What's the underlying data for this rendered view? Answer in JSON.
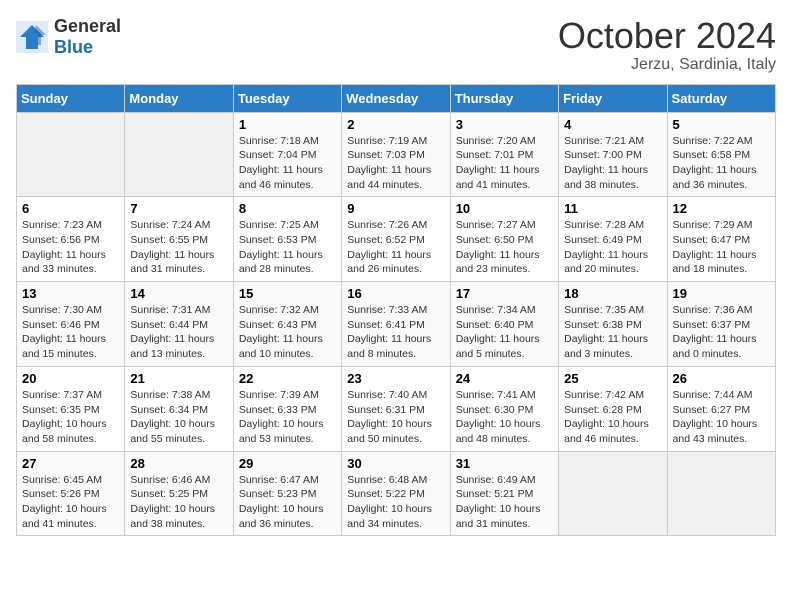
{
  "header": {
    "logo_general": "General",
    "logo_blue": "Blue",
    "month_title": "October 2024",
    "location": "Jerzu, Sardinia, Italy"
  },
  "weekdays": [
    "Sunday",
    "Monday",
    "Tuesday",
    "Wednesday",
    "Thursday",
    "Friday",
    "Saturday"
  ],
  "weeks": [
    [
      {
        "day": "",
        "info": ""
      },
      {
        "day": "",
        "info": ""
      },
      {
        "day": "1",
        "info": "Sunrise: 7:18 AM\nSunset: 7:04 PM\nDaylight: 11 hours and 46 minutes."
      },
      {
        "day": "2",
        "info": "Sunrise: 7:19 AM\nSunset: 7:03 PM\nDaylight: 11 hours and 44 minutes."
      },
      {
        "day": "3",
        "info": "Sunrise: 7:20 AM\nSunset: 7:01 PM\nDaylight: 11 hours and 41 minutes."
      },
      {
        "day": "4",
        "info": "Sunrise: 7:21 AM\nSunset: 7:00 PM\nDaylight: 11 hours and 38 minutes."
      },
      {
        "day": "5",
        "info": "Sunrise: 7:22 AM\nSunset: 6:58 PM\nDaylight: 11 hours and 36 minutes."
      }
    ],
    [
      {
        "day": "6",
        "info": "Sunrise: 7:23 AM\nSunset: 6:56 PM\nDaylight: 11 hours and 33 minutes."
      },
      {
        "day": "7",
        "info": "Sunrise: 7:24 AM\nSunset: 6:55 PM\nDaylight: 11 hours and 31 minutes."
      },
      {
        "day": "8",
        "info": "Sunrise: 7:25 AM\nSunset: 6:53 PM\nDaylight: 11 hours and 28 minutes."
      },
      {
        "day": "9",
        "info": "Sunrise: 7:26 AM\nSunset: 6:52 PM\nDaylight: 11 hours and 26 minutes."
      },
      {
        "day": "10",
        "info": "Sunrise: 7:27 AM\nSunset: 6:50 PM\nDaylight: 11 hours and 23 minutes."
      },
      {
        "day": "11",
        "info": "Sunrise: 7:28 AM\nSunset: 6:49 PM\nDaylight: 11 hours and 20 minutes."
      },
      {
        "day": "12",
        "info": "Sunrise: 7:29 AM\nSunset: 6:47 PM\nDaylight: 11 hours and 18 minutes."
      }
    ],
    [
      {
        "day": "13",
        "info": "Sunrise: 7:30 AM\nSunset: 6:46 PM\nDaylight: 11 hours and 15 minutes."
      },
      {
        "day": "14",
        "info": "Sunrise: 7:31 AM\nSunset: 6:44 PM\nDaylight: 11 hours and 13 minutes."
      },
      {
        "day": "15",
        "info": "Sunrise: 7:32 AM\nSunset: 6:43 PM\nDaylight: 11 hours and 10 minutes."
      },
      {
        "day": "16",
        "info": "Sunrise: 7:33 AM\nSunset: 6:41 PM\nDaylight: 11 hours and 8 minutes."
      },
      {
        "day": "17",
        "info": "Sunrise: 7:34 AM\nSunset: 6:40 PM\nDaylight: 11 hours and 5 minutes."
      },
      {
        "day": "18",
        "info": "Sunrise: 7:35 AM\nSunset: 6:38 PM\nDaylight: 11 hours and 3 minutes."
      },
      {
        "day": "19",
        "info": "Sunrise: 7:36 AM\nSunset: 6:37 PM\nDaylight: 11 hours and 0 minutes."
      }
    ],
    [
      {
        "day": "20",
        "info": "Sunrise: 7:37 AM\nSunset: 6:35 PM\nDaylight: 10 hours and 58 minutes."
      },
      {
        "day": "21",
        "info": "Sunrise: 7:38 AM\nSunset: 6:34 PM\nDaylight: 10 hours and 55 minutes."
      },
      {
        "day": "22",
        "info": "Sunrise: 7:39 AM\nSunset: 6:33 PM\nDaylight: 10 hours and 53 minutes."
      },
      {
        "day": "23",
        "info": "Sunrise: 7:40 AM\nSunset: 6:31 PM\nDaylight: 10 hours and 50 minutes."
      },
      {
        "day": "24",
        "info": "Sunrise: 7:41 AM\nSunset: 6:30 PM\nDaylight: 10 hours and 48 minutes."
      },
      {
        "day": "25",
        "info": "Sunrise: 7:42 AM\nSunset: 6:28 PM\nDaylight: 10 hours and 46 minutes."
      },
      {
        "day": "26",
        "info": "Sunrise: 7:44 AM\nSunset: 6:27 PM\nDaylight: 10 hours and 43 minutes."
      }
    ],
    [
      {
        "day": "27",
        "info": "Sunrise: 6:45 AM\nSunset: 5:26 PM\nDaylight: 10 hours and 41 minutes."
      },
      {
        "day": "28",
        "info": "Sunrise: 6:46 AM\nSunset: 5:25 PM\nDaylight: 10 hours and 38 minutes."
      },
      {
        "day": "29",
        "info": "Sunrise: 6:47 AM\nSunset: 5:23 PM\nDaylight: 10 hours and 36 minutes."
      },
      {
        "day": "30",
        "info": "Sunrise: 6:48 AM\nSunset: 5:22 PM\nDaylight: 10 hours and 34 minutes."
      },
      {
        "day": "31",
        "info": "Sunrise: 6:49 AM\nSunset: 5:21 PM\nDaylight: 10 hours and 31 minutes."
      },
      {
        "day": "",
        "info": ""
      },
      {
        "day": "",
        "info": ""
      }
    ]
  ]
}
